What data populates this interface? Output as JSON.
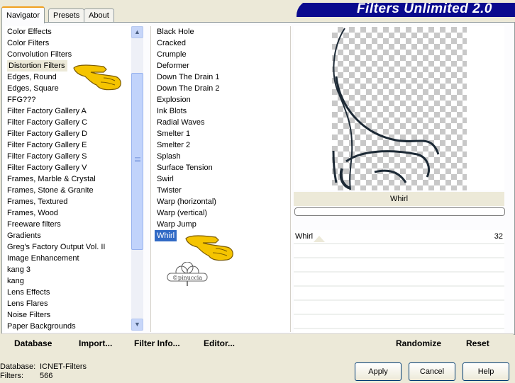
{
  "tabs": [
    "Navigator",
    "Presets",
    "About"
  ],
  "app_title": "Filters Unlimited 2.0",
  "categories": [
    "Color Effects",
    "Color Filters",
    "Convolution Filters",
    "Distortion Filters",
    "Edges, Round",
    "Edges, Square",
    "FFG???",
    "Filter Factory Gallery A",
    "Filter Factory Gallery C",
    "Filter Factory Gallery D",
    "Filter Factory Gallery E",
    "Filter Factory Gallery S",
    "Filter Factory Gallery V",
    "Frames, Marble & Crystal",
    "Frames, Stone & Granite",
    "Frames, Textured",
    "Frames, Wood",
    "Freeware filters",
    "Gradients",
    "Greg's Factory Output Vol. II",
    "Image Enhancement",
    "kang 3",
    "kang",
    "Lens Effects",
    "Lens Flares",
    "Noise Filters",
    "Paper Backgrounds"
  ],
  "filters": [
    "Black Hole",
    "Cracked",
    "Crumple",
    "Deformer",
    "Down The Drain 1",
    "Down The Drain 2",
    "Explosion",
    "Ink Blots",
    "Radial Waves",
    "Smelter 1",
    "Smelter 2",
    "Splash",
    "Surface Tension",
    "Swirl",
    "Twister",
    "Warp (horizontal)",
    "Warp (vertical)",
    "Warp Jump",
    "Whirl"
  ],
  "preview": {
    "filter_name": "Whirl"
  },
  "control": {
    "label": "Whirl",
    "value": "32"
  },
  "bottom_left": {
    "database": "Database",
    "import": "Import...",
    "filter_info": "Filter Info...",
    "editor": "Editor..."
  },
  "bottom_right": {
    "randomize": "Randomize",
    "reset": "Reset"
  },
  "status": {
    "database_label": "Database:",
    "database_value": "ICNET-Filters",
    "filters_label": "Filters:",
    "filters_value": "566"
  },
  "buttons": {
    "apply": "Apply",
    "cancel": "Cancel",
    "help": "Help"
  },
  "watermark": "©pinuccia",
  "colors": {
    "title_banner": "#0a0a8e",
    "selection": "#316ac5",
    "hand": "#f5c400"
  }
}
